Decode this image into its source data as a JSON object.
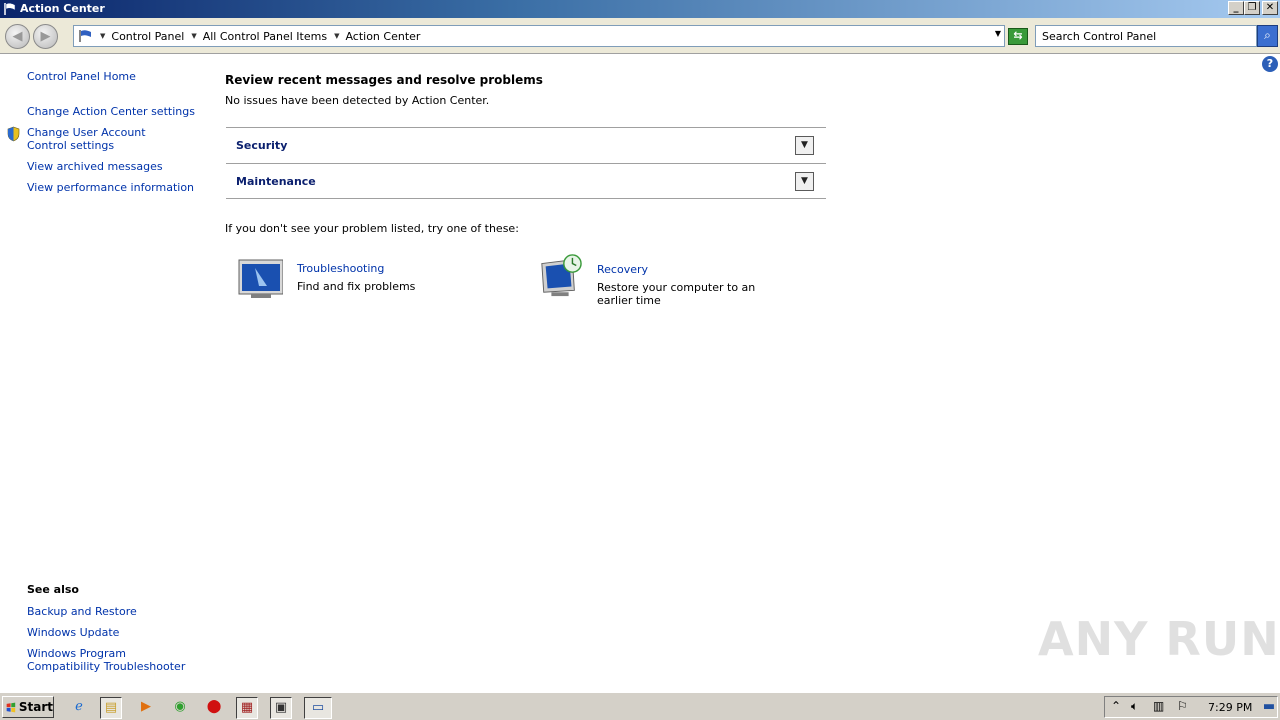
{
  "window": {
    "title": "Action Center",
    "min_label": "_",
    "restore_label": "❐",
    "close_label": "✕"
  },
  "address": {
    "crumbs": [
      "Control Panel",
      "All Control Panel Items",
      "Action Center"
    ],
    "search_placeholder": "Search Control Panel"
  },
  "left": {
    "home": "Control Panel Home",
    "tasks": [
      "Change Action Center settings",
      "Change User Account Control settings",
      "View archived messages",
      "View performance information"
    ],
    "see_also_title": "See also",
    "see_also": [
      "Backup and Restore",
      "Windows Update",
      "Windows Program Compatibility Troubleshooter"
    ]
  },
  "main": {
    "title": "Review recent messages and resolve problems",
    "subtitle": "No issues have been detected by Action Center.",
    "sections": [
      "Security",
      "Maintenance"
    ],
    "try_text": "If you don't see your problem listed, try one of these:",
    "tools": [
      {
        "name": "Troubleshooting",
        "desc": "Find and fix problems"
      },
      {
        "name": "Recovery",
        "desc": "Restore your computer to an earlier time"
      }
    ]
  },
  "watermark": "ANY RUN",
  "taskbar": {
    "start": "Start",
    "clock": "7:29 PM"
  }
}
